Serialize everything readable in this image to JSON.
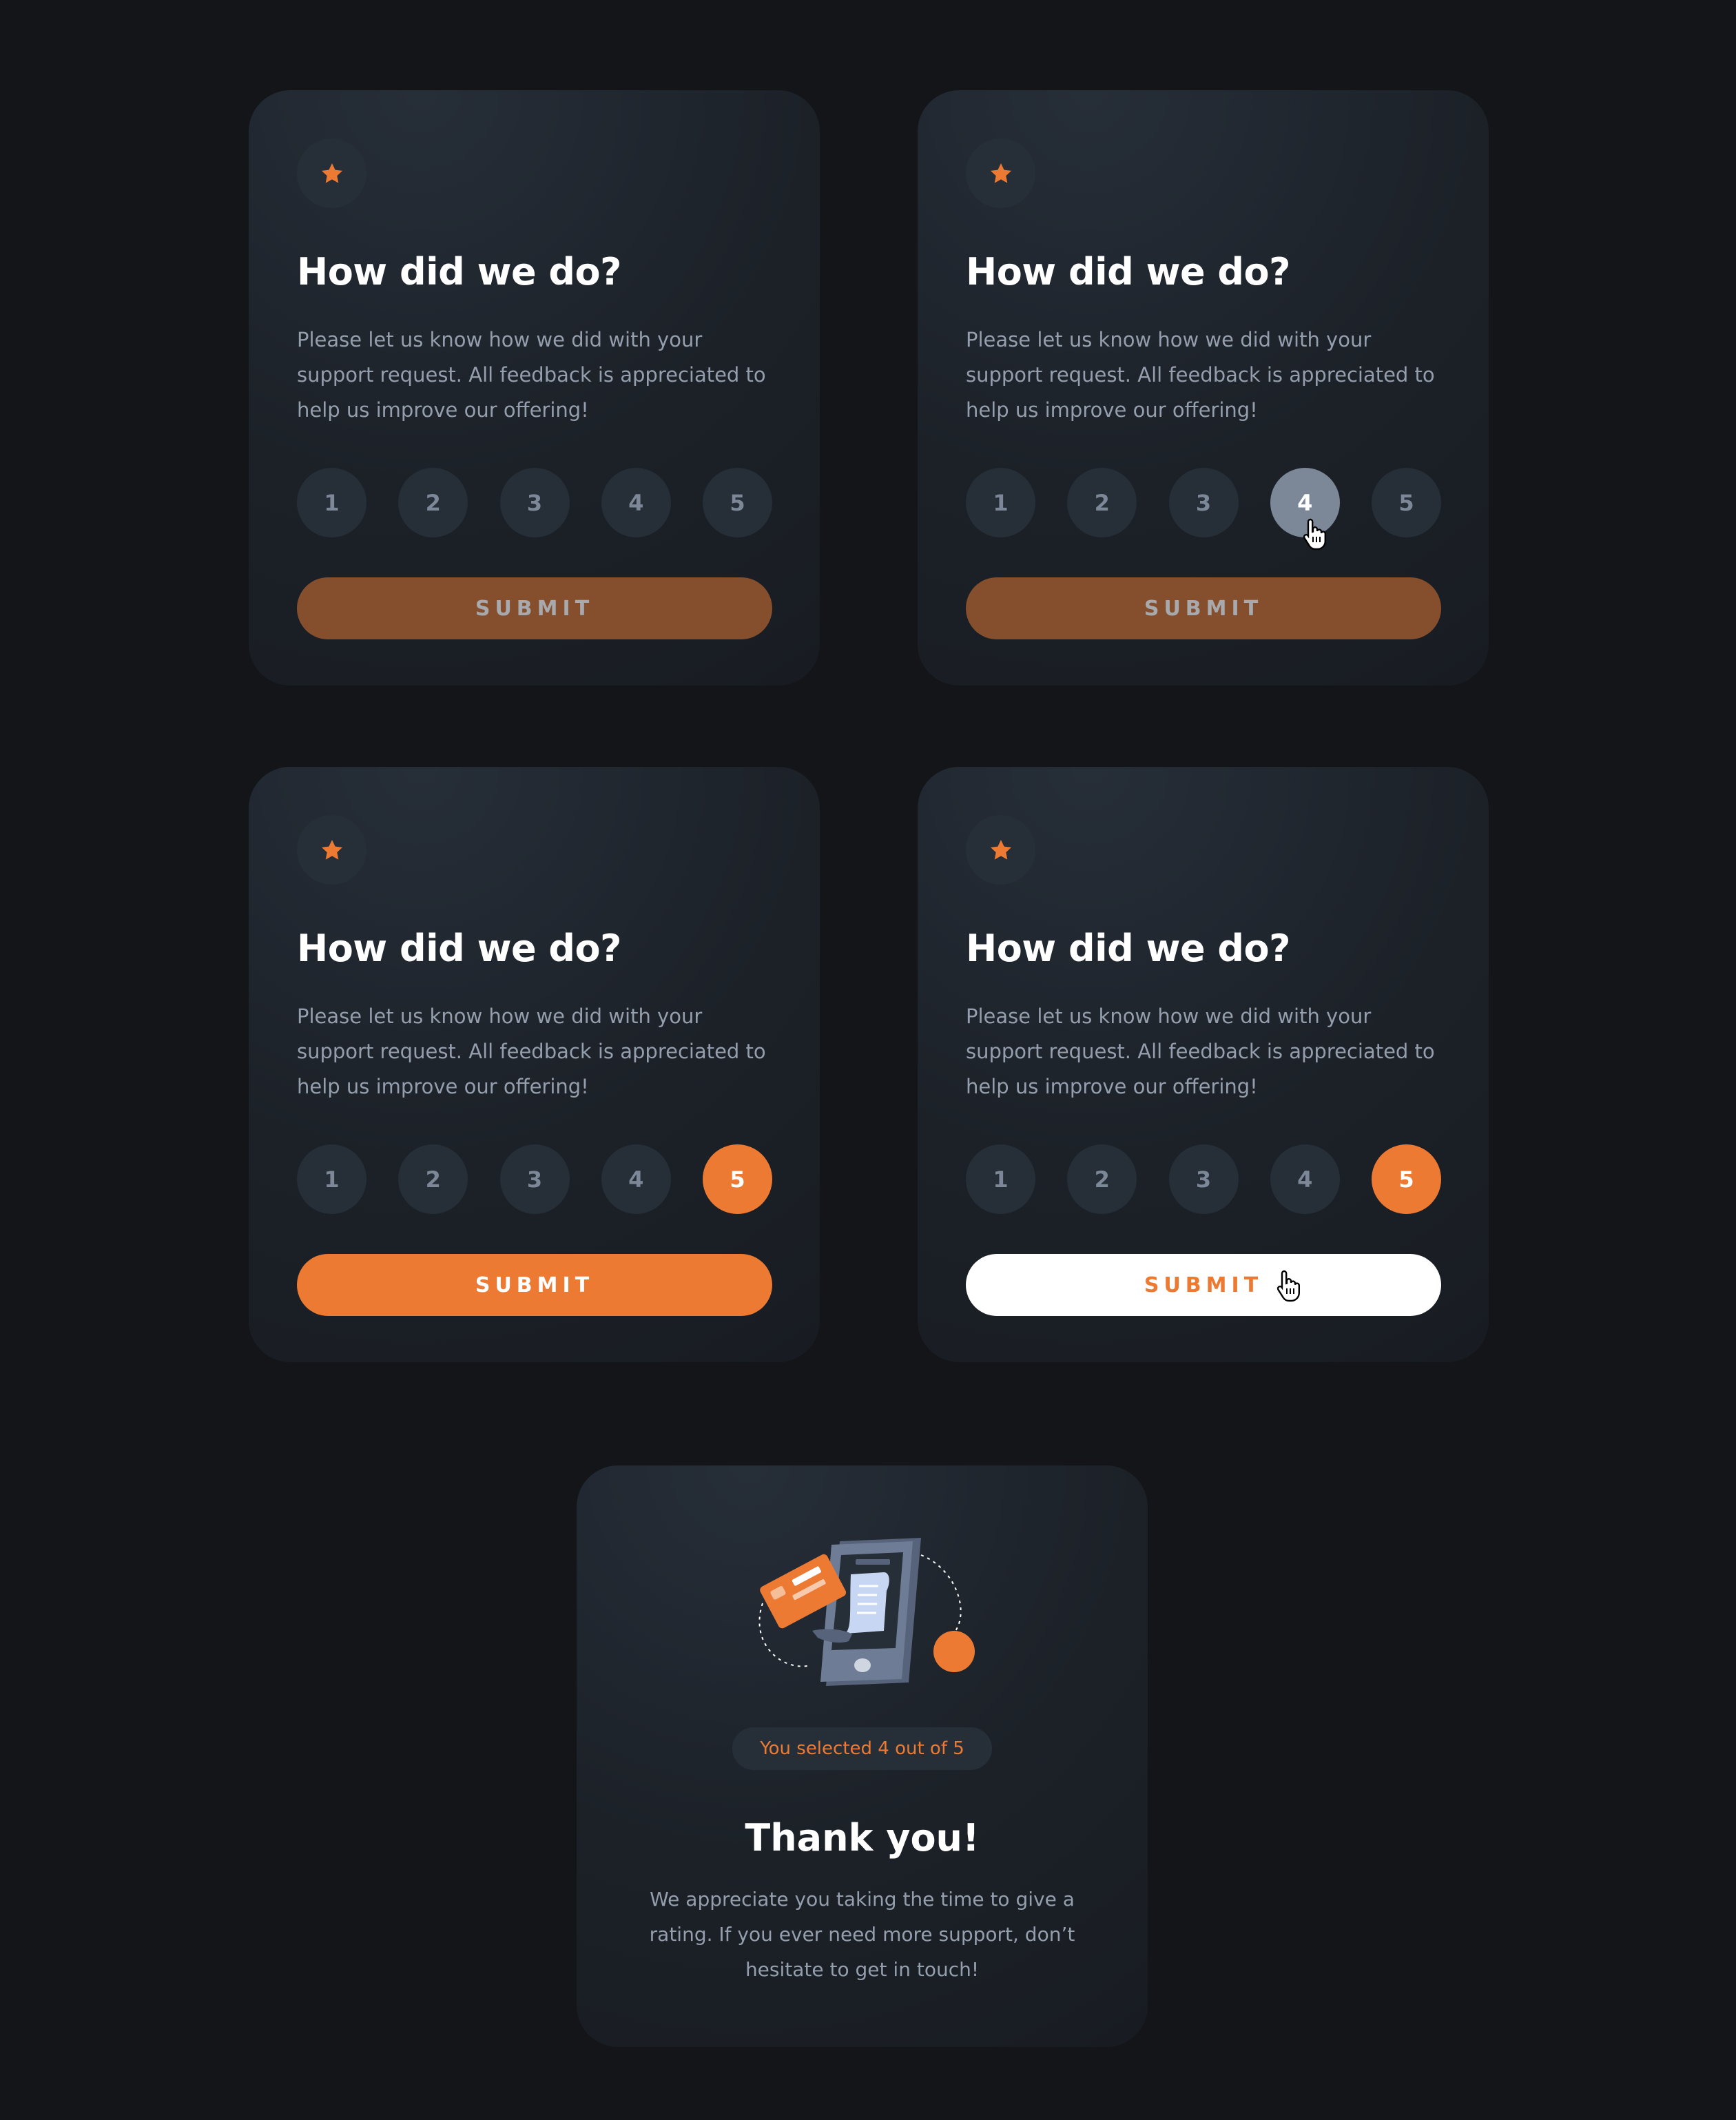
{
  "colors": {
    "page_background": "#131518",
    "card_background": "#1c2128",
    "accent_orange": "#ec7a33",
    "muted_orange": "#854f2e",
    "rating_background": "#262f38",
    "rating_text": "#7c8798",
    "hover_gray": "#7c8798",
    "body_text": "#959eac",
    "white": "#ffffff"
  },
  "rating_card": {
    "icon": "star-icon",
    "title": "How did we do?",
    "description": "Please let us know how we did with your support request. All feedback is appreciated to help us improve our offering!",
    "ratings": [
      "1",
      "2",
      "3",
      "4",
      "5"
    ],
    "submit_label": "SUBMIT"
  },
  "states": [
    {
      "name": "default",
      "hovered_rating": null,
      "selected_rating": null,
      "submit_state": "disabled",
      "cursor": "none"
    },
    {
      "name": "hover-rating",
      "hovered_rating": "4",
      "selected_rating": null,
      "submit_state": "disabled",
      "cursor": "on-rating-4"
    },
    {
      "name": "selected",
      "hovered_rating": null,
      "selected_rating": "5",
      "submit_state": "active",
      "cursor": "none"
    },
    {
      "name": "hover-submit",
      "hovered_rating": null,
      "selected_rating": "5",
      "submit_state": "hover",
      "cursor": "on-submit"
    }
  ],
  "thank_you_card": {
    "illustration": "phone-payment-illustration",
    "selected_text": "You selected 4 out of 5",
    "title": "Thank you!",
    "description": "We appreciate you taking the time to give a rating. If you ever need more support, don’t hesitate to get in touch!"
  }
}
